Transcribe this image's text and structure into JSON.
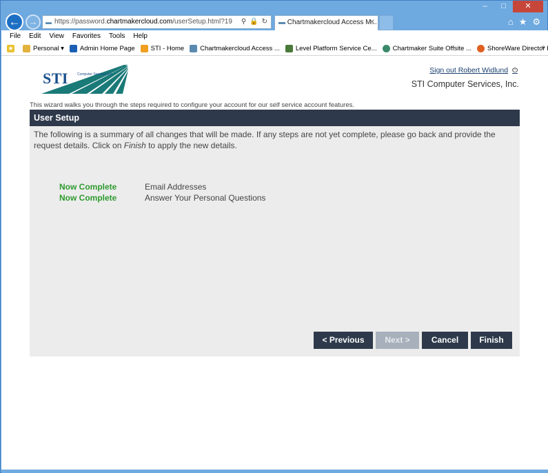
{
  "browser": {
    "url_prefix": "https://password.",
    "url_domain": "chartmakercloud.com",
    "url_path": "/userSetup.html?19",
    "tab_title": "Chartmakercloud Access M...",
    "menu": [
      "File",
      "Edit",
      "View",
      "Favorites",
      "Tools",
      "Help"
    ],
    "favorites": [
      {
        "label": "Personal ▾",
        "icon": "folder-icon",
        "color": "#e3b23c"
      },
      {
        "label": "Admin Home Page",
        "icon": "outlook-icon",
        "color": "#1a5fb4"
      },
      {
        "label": "STI - Home",
        "icon": "sti-icon",
        "color": "#f0a020"
      },
      {
        "label": "Chartmakercloud Access ...",
        "icon": "chartmaker-icon",
        "color": "#5a8ab0"
      },
      {
        "label": "Level Platform Service Ce...",
        "icon": "gear-icon",
        "color": "#4a7a3a"
      },
      {
        "label": "Chartmaker Suite Offsite ...",
        "icon": "globe-icon",
        "color": "#3a8a6a"
      },
      {
        "label": "ShoreWare Director Login",
        "icon": "shoretel-icon",
        "color": "#e06020"
      }
    ]
  },
  "header": {
    "logo_text": "STI",
    "logo_subtext": "Computer Services Inc.",
    "signout_label": "Sign out Robert Widlund",
    "company_name": "STI Computer Services, Inc."
  },
  "intro_text": "This wizard walks you through the steps required to configure your account for our self service account features.",
  "panel": {
    "title": "User Setup",
    "summary_before": "The following is a summary of all changes that will be made. If any steps are not yet complete, please go back and provide the request details. Click on ",
    "summary_finish": "Finish",
    "summary_after": " to apply the new details.",
    "steps": [
      {
        "status": "Now Complete",
        "name": "Email Addresses"
      },
      {
        "status": "Now Complete",
        "name": "Answer Your Personal Questions"
      }
    ],
    "buttons": {
      "previous": "< Previous",
      "next": "Next >",
      "cancel": "Cancel",
      "finish": "Finish"
    }
  },
  "colors": {
    "header_bg": "#2e3a4b",
    "complete_green": "#2e9a2e",
    "panel_bg": "#ececec"
  }
}
